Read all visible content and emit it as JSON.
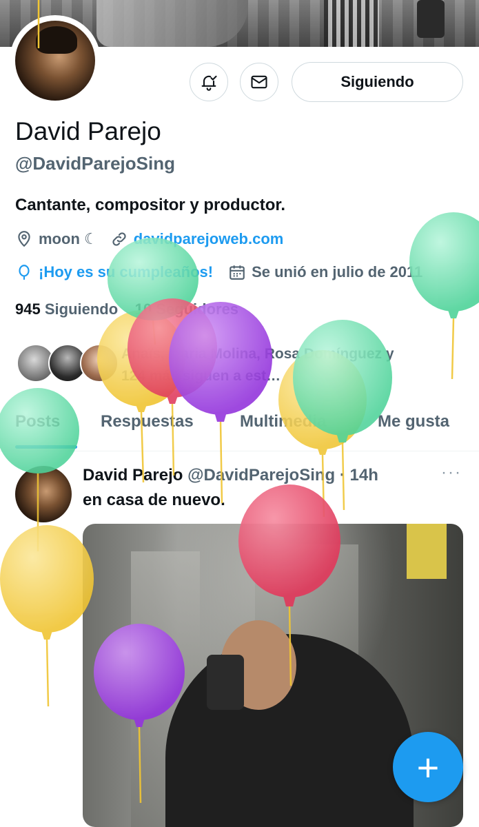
{
  "profile": {
    "name": "David Parejo",
    "handle": "@DavidParejoSing",
    "bio": "Cantante, compositor y productor.",
    "location": "moon ☾",
    "website": "davidparejoweb.com",
    "birthday": "¡Hoy es su cumpleaños!",
    "joined": "Se unió en julio de 2011",
    "following_count": "945",
    "following_label": "Siguiendo",
    "followers_count": "10",
    "followers_label": "Seguidores",
    "followed_by": "Anaïs, Maria Molina, Rosa Domínguez y 124 más siguen a est…",
    "follow_button": "Siguiendo"
  },
  "icons": {
    "bell": "bell-check-icon",
    "mail": "mail-icon",
    "location": "location-pin-icon",
    "link": "link-icon",
    "balloon": "balloon-icon",
    "calendar": "calendar-icon",
    "more": "more-icon",
    "compose": "plus-icon"
  },
  "tabs": [
    {
      "label": "Posts",
      "active": true
    },
    {
      "label": "Respuestas",
      "active": false
    },
    {
      "label": "Multimedia",
      "active": false
    },
    {
      "label": "Me gusta",
      "active": false
    }
  ],
  "post": {
    "author": "David Parejo",
    "handle": "@DavidParejoSing",
    "separator": "·",
    "time": "14h",
    "more": "···",
    "text": "en casa de nuevo."
  },
  "fab": {
    "label": "+"
  },
  "colors": {
    "accent": "#1d9bf0",
    "secondary_text": "#536471",
    "balloon_green": "#6ddfae",
    "balloon_yellow": "#f2cf4a",
    "balloon_red": "#e84d6a",
    "balloon_purple": "#a24be0"
  }
}
